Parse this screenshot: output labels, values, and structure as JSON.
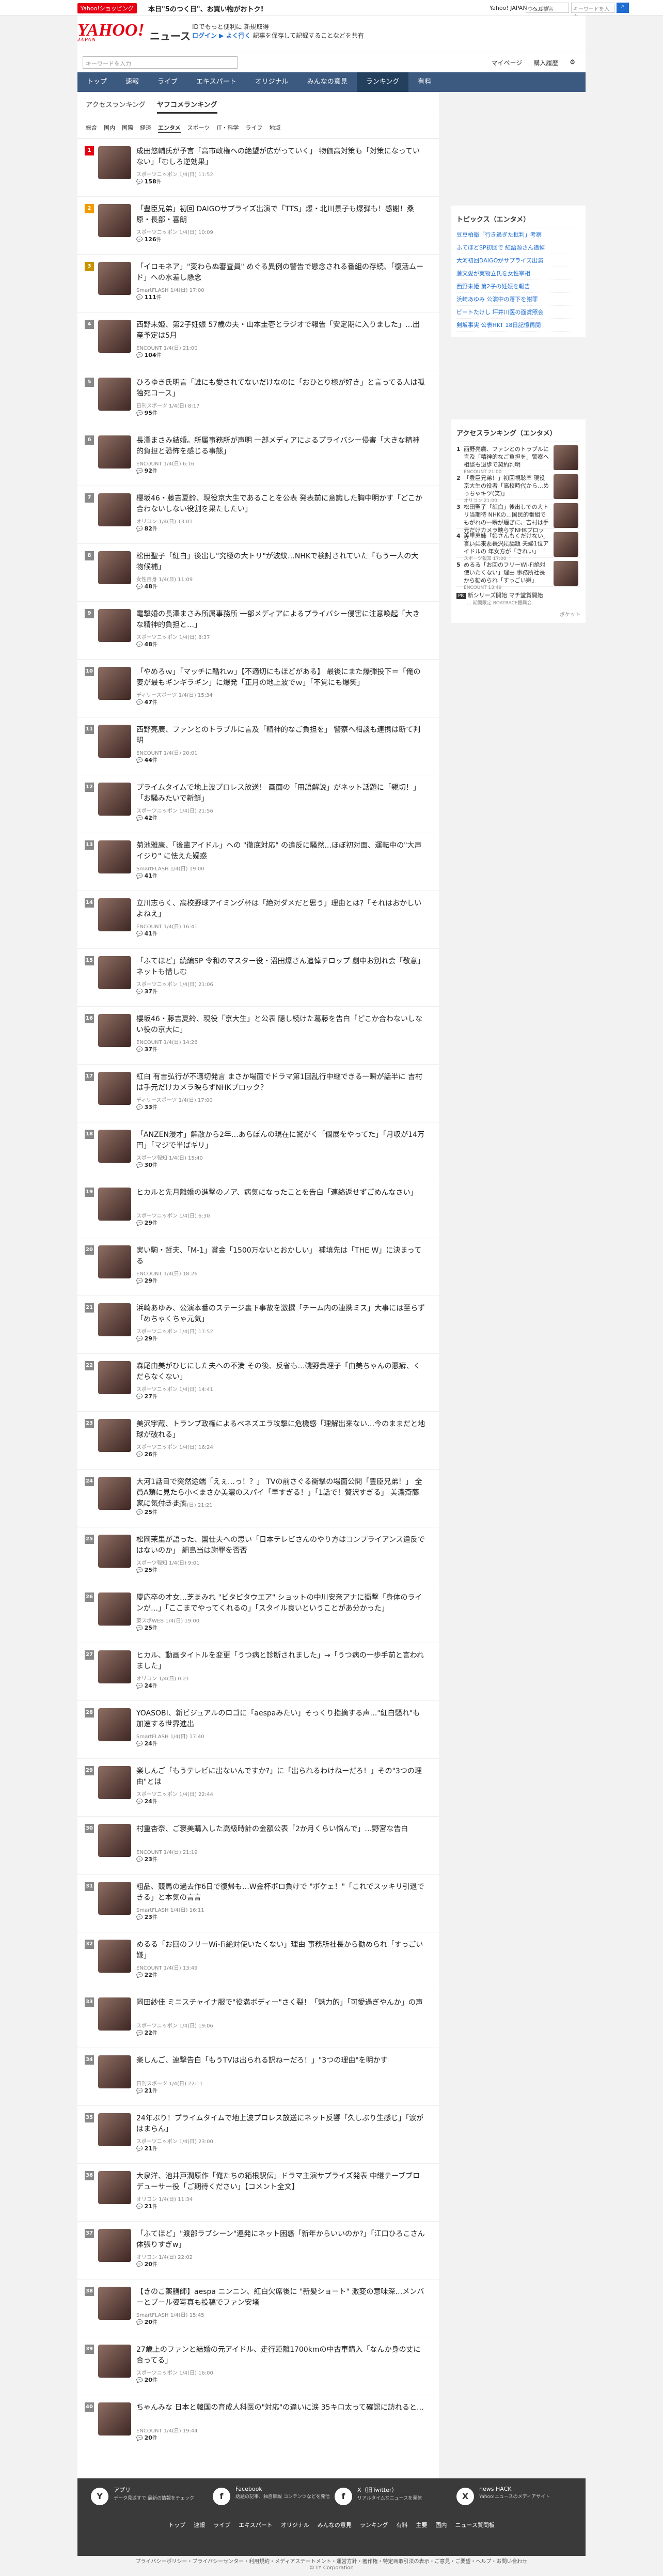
{
  "topbar": {
    "shop": "Yahoo!ショッピング",
    "promo": "本日\"5のつく日\"、お買い物がおトク!",
    "links": [
      "Yahoo! JAPAN",
      "ヘルプ"
    ],
    "search_placeholder": "ウェブ検索",
    "keyword_placeholder": "キーワードを入力"
  },
  "header": {
    "logo": "YAHOO!",
    "logo_sub": "JAPAN",
    "brand": "ニュース",
    "caption1": "IDでもっと便利に 新規取得",
    "caption2": "ログイン ▶ よく行く ",
    "caption3": "記事を保存して記録することなどを共有"
  },
  "subbar": {
    "search_placeholder": "キーワードを入力",
    "mypage": "マイページ",
    "subscription": "購入履歴",
    "settings": "⚙"
  },
  "nav": [
    "トップ",
    "速報",
    "ライブ",
    "エキスパート",
    "オリジナル",
    "みんなの意見",
    "ランキング",
    "有料"
  ],
  "ranking_tabs": [
    "アクセスランキング",
    "ヤフコメランキング"
  ],
  "genre_tabs": [
    "総合",
    "国内",
    "国際",
    "経済",
    "エンタメ",
    "スポーツ",
    "IT・科学",
    "ライフ",
    "地域"
  ],
  "items": [
    {
      "rank": "1",
      "title": "成田悠輔氏が予言「高市政権への絶望が広がっていく」 物価高対策も「対策になっていない」「むしろ逆効果」",
      "meta": "スポーツニッポン 1/4(日) 11:52",
      "comments": "158"
    },
    {
      "rank": "2",
      "title": "「豊臣兄弟」初回 DAIGOサプライズ出演で「TTS」爆・北川景子も爆弾も！感謝！桑原・長部・喜朗",
      "meta": "スポーツニッポン 1/4(日) 10:09",
      "comments": "126"
    },
    {
      "rank": "3",
      "title": "「イロモネア」\"変わらぬ審査員\" めぐる異例の警告で懸念される番組の存続、「復活ムード」への水差し懸念",
      "meta": "SmartFLASH 1/4(日) 17:00",
      "comments": "111"
    },
    {
      "rank": "4",
      "title": "西野未姫、第2子妊娠 57歳の夫・山本圭壱とラジオで報告「安定期に入りました」…出産予定は5月",
      "meta": "ENCOUNT 1/4(日) 21:00",
      "comments": "104"
    },
    {
      "rank": "5",
      "title": "ひろゆき氏明言「誰にも愛されてないだけなのに「おひとり様が好き」と言ってる人は孤独死コース」",
      "meta": "日刊スポーツ 1/4(日) 8:17",
      "comments": "95"
    },
    {
      "rank": "6",
      "title": "長澤まさみ結婚。所属事務所が声明 一部メディアによるプライバシー侵害「大きな精神的負担と恐怖を感じる事態」",
      "meta": "ENCOUNT 1/4(日) 6:16",
      "comments": "92"
    },
    {
      "rank": "7",
      "title": "櫻坂46・藤吉夏鈴、現役京大生であることを公表 発表前に意識した胸中明かす「どこか合わないしない役割を果たしたい」",
      "meta": "オリコン 1/4(日) 13:01",
      "comments": "82"
    },
    {
      "rank": "8",
      "title": "松田聖子「紅白」後出し\"究極の大トリ\"が波紋…NHKで検討されていた「もう一人の大物候補」",
      "meta": "女性自身 1/4(日) 11:09",
      "comments": "48"
    },
    {
      "rank": "9",
      "title": "電撃婚の長澤まさみ所属事務所 一部メディアによるプライバシー侵害に注意喚起「大きな精神的負担と…」",
      "meta": "スポーツニッポン 1/4(日) 8:37",
      "comments": "48"
    },
    {
      "rank": "10",
      "title": "「やめろｗ」「マッチに酷れｗ」【不適切にもほどがある】 最後にまた爆弾投下＝「俺の妻が最もギンギラギン」に爆発「正月の地上波でｗ」「不覚にも爆笑」",
      "meta": "ディリースポーツ 1/4(日) 15:34",
      "comments": "47"
    },
    {
      "rank": "11",
      "title": "西野亮廣、ファンとのトラブルに言及「精神的なご負担を」 警察へ相談も連携は断て判明",
      "meta": "ENCOUNT 1/4(日) 20:01",
      "comments": "44"
    },
    {
      "rank": "12",
      "title": "プライムタイムで地上波プロレス放送！ 画面の「用語解説」がネット話題に「親切！」「お騒みたいで新鮮」",
      "meta": "スポーツニッポン 1/4(日) 21:56",
      "comments": "42"
    },
    {
      "rank": "13",
      "title": "菊池雅康、「後輩アイドル」への \"徹底対応\" の違反に騒然…ほぼ初対面、運転中の\"大声イジり\" に怯えた疑惑",
      "meta": "SmartFLASH 1/4(日) 19:00",
      "comments": "41"
    },
    {
      "rank": "14",
      "title": "立川志らく、高校野球アイミング杯は「絶対ダメだと思う」理由とは?「それはおかしいよねえ」",
      "meta": "ENCOUNT 1/4(日) 16:41",
      "comments": "41"
    },
    {
      "rank": "15",
      "title": "「ふてほど」続編SP 令和のマスター役・沼田爆さん追悼テロップ 劇中お別れ会「敬意」ネットも惜しむ",
      "meta": "スポーツニッポン 1/4(日) 21:06",
      "comments": "37"
    },
    {
      "rank": "16",
      "title": "櫻坂46・藤吉夏鈴、現役「京大生」と公表 隠し続けた葛藤を告白「どこか合わないしない役の京大に」",
      "meta": "ENCOUNT 1/4(日) 14:26",
      "comments": "37"
    },
    {
      "rank": "17",
      "title": "紅白 有吉弘行が不適切発言 まさか場面でドラマ第1回乱行中継できる一瞬が話半に 吉村は手元だけカメラ映らずNHKブロック？",
      "meta": "ディリースポーツ 1/4(日) 17:00",
      "comments": "33"
    },
    {
      "rank": "18",
      "title": "「ANZEN漫才」解散から2年…あらぽんの現在に驚がく「個展をやってた」「月収が14万円」「マジで半ばギリ」",
      "meta": "スポーツ報知 1/4(日) 15:40",
      "comments": "30"
    },
    {
      "rank": "19",
      "title": "ヒカルと先月離婚の進撃のノア、病気になったことを告白「連絡返せずごめんなさい」",
      "meta": "スポーツニッポン 1/4(日) 6:30",
      "comments": "29"
    },
    {
      "rank": "20",
      "title": "実い駒・哲夫、「M-1」賞金「1500万ないとおかしい」 補填先は「THE W」に決まってる",
      "meta": "ENCOUNT 1/4(日) 18:26",
      "comments": "29"
    },
    {
      "rank": "21",
      "title": "浜崎あゆみ、公演本番のステージ裏下事故を激撰「チーム内の連携ミス」大事には至らず「めちゃくちゃ元気」",
      "meta": "スポーツニッポン 1/4(日) 17:52",
      "comments": "29"
    },
    {
      "rank": "22",
      "title": "森尾由美がひじにした夫への不満 その後、反省も…磯野貴理子「由美ちゃんの悪癖、くだらなくない」",
      "meta": "スポーツニッポン 1/4(日) 14:41",
      "comments": "27"
    },
    {
      "rank": "23",
      "title": "美沢宇蔵、トランプ政権によるベネズエラ攻撃に危機感「理解出来ない…今のままだと地球が破れる」",
      "meta": "スポーツニッポン 1/4(日) 16:24",
      "comments": "26"
    },
    {
      "rank": "24",
      "title": "大河1話目で突然途端「えぇ…っ！？」 TVの前さぐる衝撃の場面公開「豊臣兄弟！」 全員A類に見たら小＜まさか美濃のスパイ「早すぎる！」「1話で！贅沢すぎる」 美濃斎藤家に気付きます",
      "meta": "ディリースポーツ 1/4(日) 21:21",
      "comments": "25"
    },
    {
      "rank": "25",
      "title": "松岡茉里が語った、国仕夫への思い「日本テレビさんのやり方はコンプライアンス違反ではないのか」 組島当は謝罪を否否",
      "meta": "スポーツ報知 1/4(日) 9:01",
      "comments": "25"
    },
    {
      "rank": "26",
      "title": "慶応卒の才女…芝まみれ \"ビタビタウエア\" ショットの中川安奈アナに衝撃「身体のラインが…」「ここまでやってくれるの」「スタイル良いということがあ分かった」",
      "meta": "東スポWEB 1/4(日) 19:00",
      "comments": "25"
    },
    {
      "rank": "27",
      "title": "ヒカル、動画タイトルを変更「うつ病と診断されました」→「うつ病の一歩手前と言われました」",
      "meta": "オリコン 1/4(日) 0:21",
      "comments": "24"
    },
    {
      "rank": "28",
      "title": "YOASOBI、新ビジュアルのロゴに「aespaみたい」そっくり指摘する声…\"紅白騒れ\"も加速する世界進出",
      "meta": "SmartFLASH 1/4(日) 17:40",
      "comments": "24"
    },
    {
      "rank": "29",
      "title": "楽しんご「もうテレビに出ないんですか?」に「出られるわけねーだろ！」その\"3つの理由\"とは",
      "meta": "スポーツニッポン 1/4(日) 22:44",
      "comments": "24"
    },
    {
      "rank": "30",
      "title": "村重杏奈、ご褒美購入した高級時計の金額公表「2か月くらい悩んで」…野宮な告白",
      "meta": "ENCOUNT 1/4(日) 21:19",
      "comments": "23"
    },
    {
      "rank": "31",
      "title": "粗品、競馬の過去作6日で復帰も…W金杯ボロ負けで \"ボケェ！\"「これでスッキリ引退できる」と本気の言言",
      "meta": "SmartFLASH 1/4(日) 16:11",
      "comments": "23"
    },
    {
      "rank": "32",
      "title": "めるる「お回のフリーWi-Fi絶対使いたくない」理由 事務所社長から勧められ「すっごい嫌」",
      "meta": "ENCOUNT 1/4(日) 13:49",
      "comments": "22"
    },
    {
      "rank": "33",
      "title": "岡田紗佳 ミニスチャイナ服で\"役満ボディー\"さく裂！「魅力的」「可愛過ぎやんか」の声",
      "meta": "スポーツニッポン 1/4(日) 19:06",
      "comments": "22"
    },
    {
      "rank": "34",
      "title": "楽しんご、連撃告白「もうTVは出られる訳ねーだろ！」\"3つの理由\"を明かす",
      "meta": "日刊スポーツ 1/4(日) 22:11",
      "comments": "21"
    },
    {
      "rank": "35",
      "title": "24年ぶり！プライムタイムで地上波プロレス放送にネット反響「久しぶり生感じ」「涙がはまらん」",
      "meta": "スポーツニッポン 1/4(日) 23:00",
      "comments": "21"
    },
    {
      "rank": "36",
      "title": "大泉洋、池井戸潤原作「俺たちの箱根駅伝」ドラマ主演サプライズ発表 中継テーブブロデューサー役「ご期待ください」【コメント全文】",
      "meta": "オリコン 1/4(日) 11:34",
      "comments": "21"
    },
    {
      "rank": "37",
      "title": "「ふてほど」\"渡部ラブシーン\"連発にネット困惑「新年からいいのか?」「江口ひろこさん体張りすぎw」",
      "meta": "オリコン 1/4(日) 22:02",
      "comments": "20"
    },
    {
      "rank": "38",
      "title": "【きのこ薬膳師】aespa ニンニン、紅白欠席後に \"新髪ショート\" 激変の意味深…メンバーとプール姿写真も投稿でファン安堵",
      "meta": "SmartFLASH 1/4(日) 15:45",
      "comments": "20"
    },
    {
      "rank": "39",
      "title": "27歳上のファンと結婚の元アイドル、走行距離1700kmの中古車購入「なんか身の丈に合ってる」",
      "meta": "スポーツニッポン 1/4(日) 16:00",
      "comments": "20"
    },
    {
      "rank": "40",
      "title": "ちゃんみな 日本と韓国の育成人科医の\"対応\"の違いに涙 35キロ太って確認に訪れると…",
      "meta": "ENCOUNT 1/4(日) 19:44",
      "comments": "20"
    }
  ],
  "comments_suffix": "件",
  "sidebar": {
    "topics_title": "トピックス（エンタメ）",
    "topics": [
      "豆豆柏衛「行き過ぎた批判」考察",
      "ふてほどSP初回で 紅語源さん追悼",
      "大河初回DAIGOがサプライズ出演",
      "藤文愛が実物立氏を女性宰相",
      "西野未姫 第2子の妊娠を報告",
      "浜崎あゆみ 公演中の落下を謝罪",
      "ビートたけし 坪井川医の面賞照会",
      "剣坂事実 公表HKT 18日記憶再開"
    ],
    "ranking_title": "アクセスランキング（エンタメ）",
    "ranking": [
      {
        "n": "1",
        "t": "西野亮廣、ファンとのトラブルに言及「精神的なご負担を」警察へ相談も退歩で契約判明",
        "m": "ENCOUNT 21:00"
      },
      {
        "n": "2",
        "t": "「豊臣兄弟！」初回視聴率 現役京大生の役者「高校時代から…めっちゃキツ(笑)」",
        "m": "オリコン 21:00"
      },
      {
        "n": "3",
        "t": "松田聖子「紅白」後出しでの大トリ当期待 NHKの…国民的番組でもがれの一瞬が騒ぎに、吉村は手元だけカメラ映らずNHKブロック",
        "m": "ディリースポーツ 17:00"
      },
      {
        "n": "4",
        "t": "美里恵姉「娘さんもくだけない」言いに来た長沢に話題 夫婦1位アイドルの 年女方が「きれい」",
        "m": "スポーツ報知 17:00"
      },
      {
        "n": "5",
        "t": "めるる「お回のフリーWi-Fi絶対使いたくない」理由 事務所社長から勧められ「すっごい嫌」",
        "m": "ENCOUNT 13:49"
      }
    ],
    "promo_badge": "PR",
    "promo_text": "新シリーズ開始 マチ堂賞開始",
    "promo_sub": "… 期間限定 BOATRACE振興会",
    "more": "ポケット"
  },
  "footer": {
    "apps": [
      {
        "icon": "Y",
        "title": "アプリ",
        "sub": "データ見返すで 最新の情報をチェック"
      },
      {
        "icon": "f",
        "title": "Facebook",
        "sub": "話題の記事、独自解説 コンテンツなどを発信"
      },
      {
        "icon": "f",
        "title": "X（旧Twitter）",
        "sub": "リアルタイムなニュースを発信"
      },
      {
        "icon": "X",
        "title": "news HACK",
        "sub": "Yahoo!ニュースのメディアサイト"
      }
    ],
    "nav": [
      "トップ",
      "速報",
      "ライブ",
      "エキスパート",
      "オリジナル",
      "みんなの意見",
      "ランキング",
      "有料",
      "主要",
      "国内",
      "ニュース質問板"
    ],
    "legal": "プライバシーポリシー・プライバシーセンター・利用規約・メディアステートメント・運営方針・著作権・特定商取引法の表示・ご意見・ご要望・ヘルプ・お問い合わせ",
    "copyright": "© LY Corporation"
  }
}
